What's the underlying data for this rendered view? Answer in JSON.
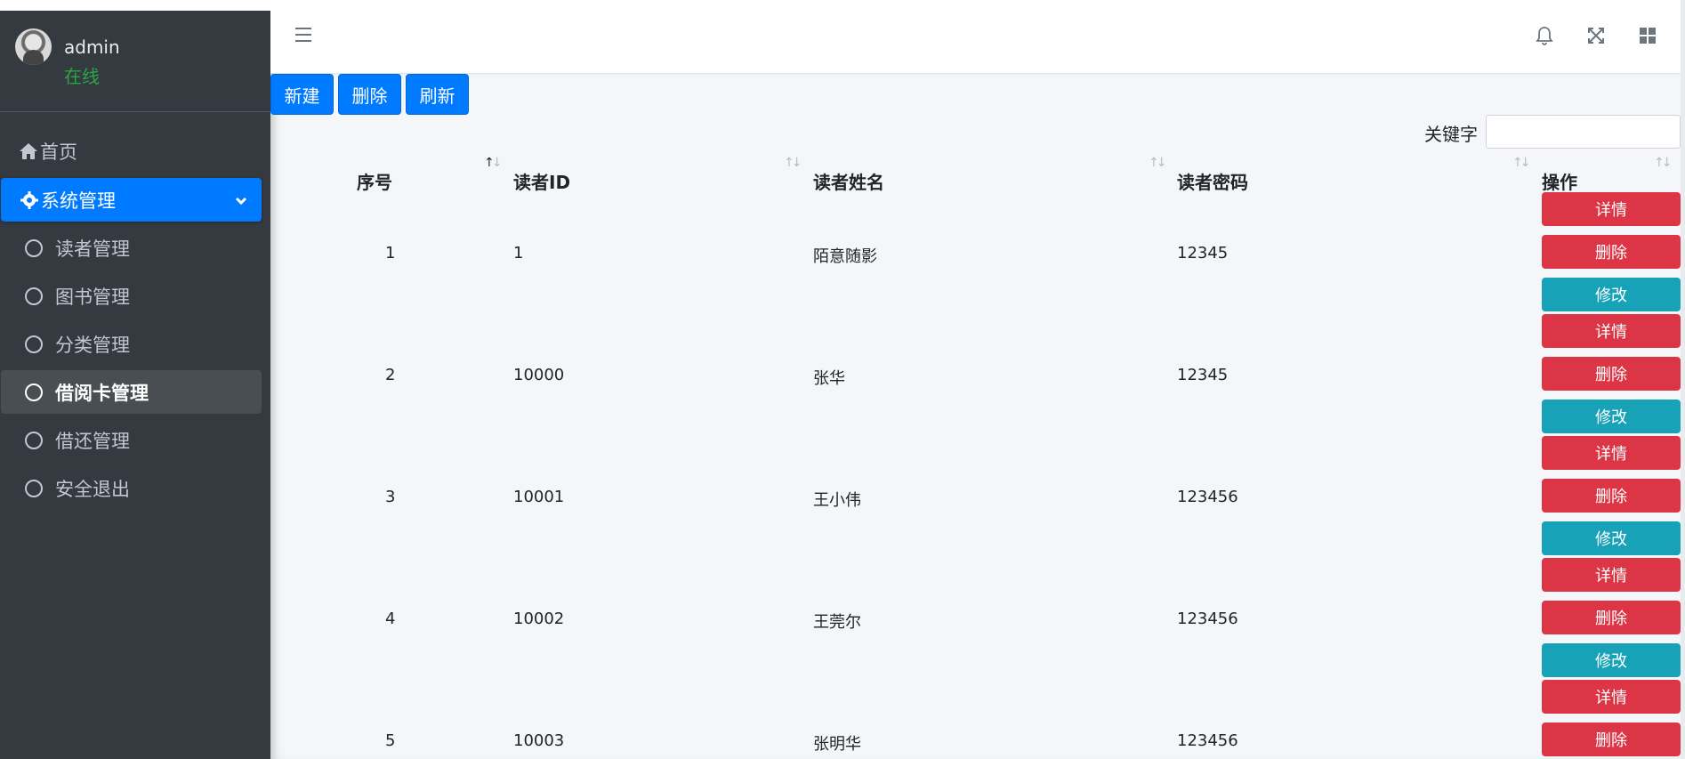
{
  "user": {
    "name": "admin",
    "status": "在线"
  },
  "nav": {
    "home": "首页",
    "system": "系统管理",
    "items": [
      "读者管理",
      "图书管理",
      "分类管理",
      "借阅卡管理",
      "借还管理",
      "安全退出"
    ]
  },
  "toolbar": {
    "new": "新建",
    "delete": "删除",
    "refresh": "刷新"
  },
  "search": {
    "label": "关键字",
    "value": "",
    "placeholder": ""
  },
  "table": {
    "headers": [
      "序号",
      "读者ID",
      "读者姓名",
      "读者密码",
      "操作"
    ],
    "rows": [
      {
        "no": "1",
        "id": "1",
        "name": "陌意随影",
        "password": "12345"
      },
      {
        "no": "2",
        "id": "10000",
        "name": "张华",
        "password": "12345"
      },
      {
        "no": "3",
        "id": "10001",
        "name": "王小伟",
        "password": "123456"
      },
      {
        "no": "4",
        "id": "10002",
        "name": "王莞尔",
        "password": "123456"
      },
      {
        "no": "5",
        "id": "10003",
        "name": "张明华",
        "password": "123456"
      }
    ],
    "actions": {
      "detail": "详情",
      "delete": "删除",
      "edit": "修改"
    }
  },
  "colors": {
    "primary": "#007bff",
    "danger": "#dc3545",
    "info": "#17a2b8",
    "sidebar": "#343a40",
    "online": "#28a745"
  }
}
